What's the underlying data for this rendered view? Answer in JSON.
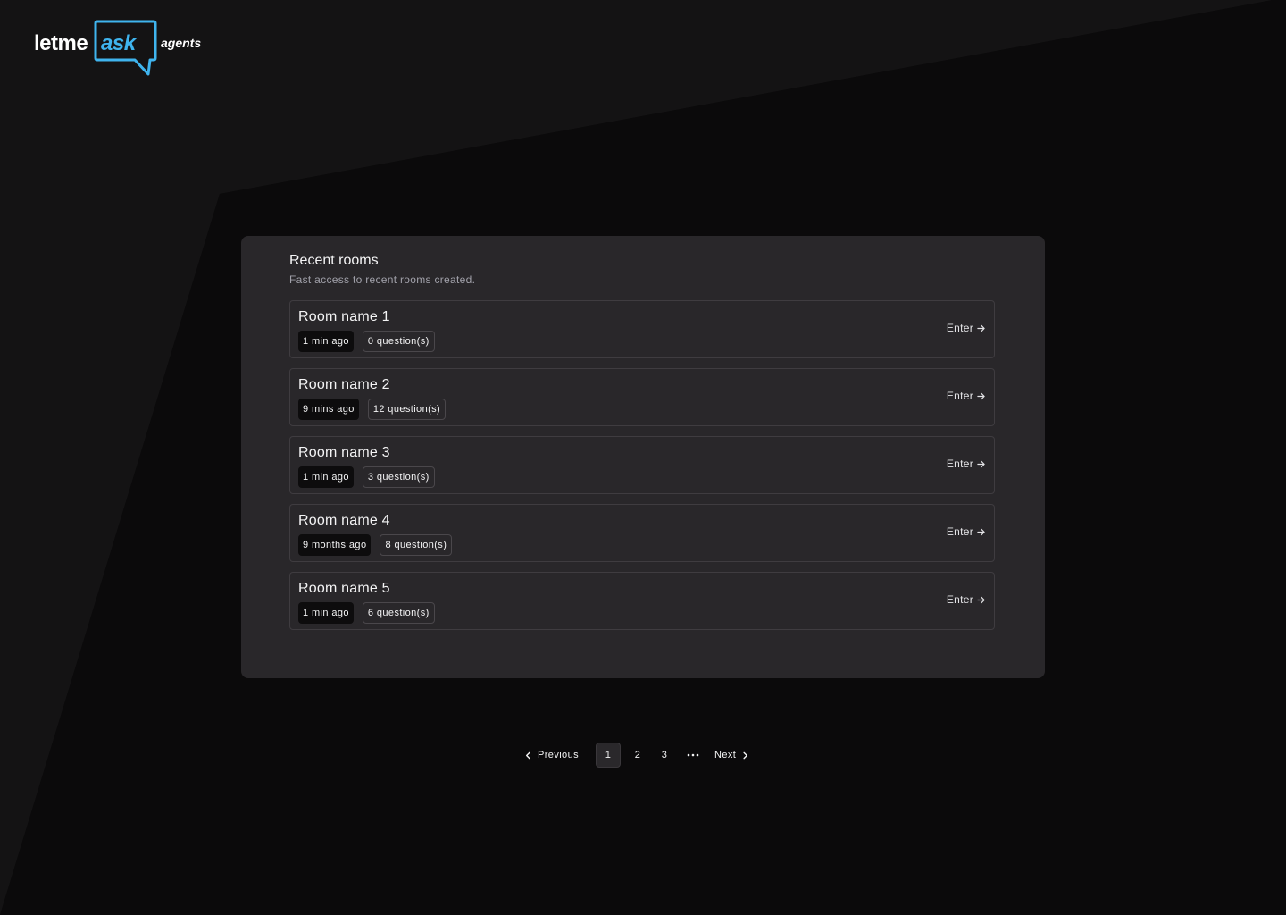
{
  "brand": {
    "word1": "letme",
    "word2": "ask",
    "word3": "agents",
    "accent_color": "#3fb4ee"
  },
  "recent_rooms": {
    "title": "Recent rooms",
    "subtitle": "Fast access to recent rooms created.",
    "enter_label": "Enter",
    "rooms": [
      {
        "name": "Room name 1",
        "time": "1 min ago",
        "questions": "0 question(s)"
      },
      {
        "name": "Room name 2",
        "time": "9 mins ago",
        "questions": "12 question(s)"
      },
      {
        "name": "Room name 3",
        "time": "1 min ago",
        "questions": "3 question(s)"
      },
      {
        "name": "Room name 4",
        "time": "9 months ago",
        "questions": "8 question(s)"
      },
      {
        "name": "Room name 5",
        "time": "1 min ago",
        "questions": "6 question(s)"
      }
    ]
  },
  "pagination": {
    "previous_label": "Previous",
    "next_label": "Next",
    "pages": [
      "1",
      "2",
      "3"
    ],
    "current_page": "1"
  },
  "icons": {
    "enter": "arrow-right-icon",
    "previous": "chevron-left-icon",
    "next": "chevron-right-icon",
    "more": "ellipsis-icon"
  }
}
